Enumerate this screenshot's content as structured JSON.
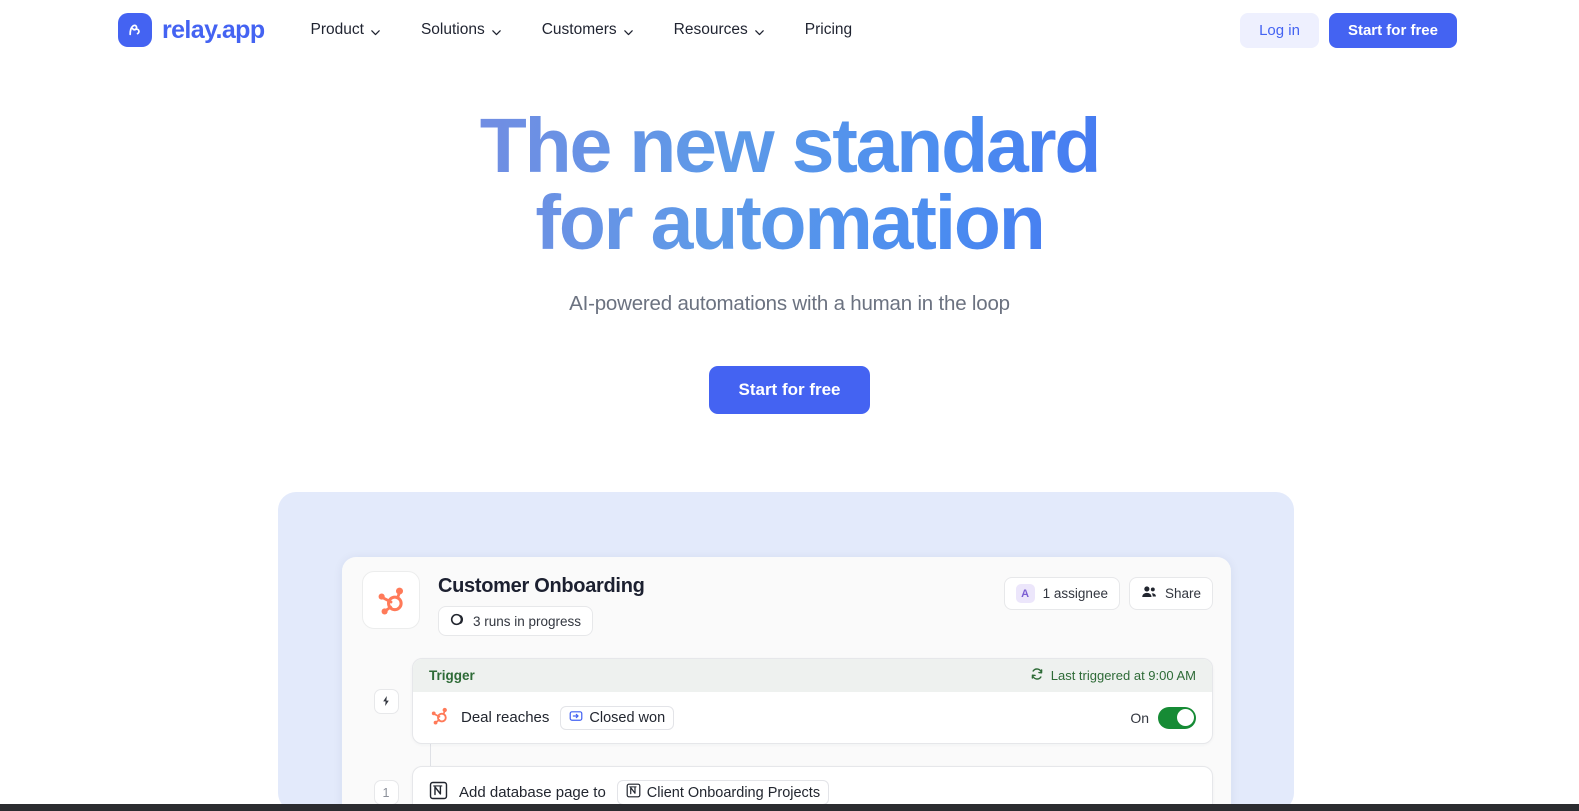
{
  "brand": {
    "name": "relay.app",
    "logo_icon": "relay-logo-icon",
    "accent": "#4463f2"
  },
  "nav": {
    "links": [
      {
        "label": "Product",
        "has_dropdown": true
      },
      {
        "label": "Solutions",
        "has_dropdown": true
      },
      {
        "label": "Customers",
        "has_dropdown": true
      },
      {
        "label": "Resources",
        "has_dropdown": true
      },
      {
        "label": "Pricing",
        "has_dropdown": false
      }
    ],
    "login_label": "Log in",
    "signup_label": "Start for free"
  },
  "hero": {
    "headline_line1": "The new standard",
    "headline_line2": "for automation",
    "subheadline": "AI-powered automations with a human in the loop",
    "cta_label": "Start for free",
    "gradient_from": "#9a7ad6",
    "gradient_to": "#3d5ef4"
  },
  "demo": {
    "showcase_bg": "#e3eafb",
    "app_icon": "hubspot-icon",
    "flow_title": "Customer Onboarding",
    "runs_chip": {
      "icon": "progress-circle-icon",
      "label": "3 runs in progress"
    },
    "assignee_pill": {
      "avatar_initial": "A",
      "label": "1 assignee",
      "avatar_color": "#7c5fd3"
    },
    "share_pill": {
      "icon": "people-icon",
      "label": "Share"
    },
    "trigger": {
      "header_label": "Trigger",
      "header_status_icon": "refresh-icon",
      "header_status": "Last triggered at 9:00 AM",
      "gutter_icon": "lightning-icon",
      "app_icon": "hubspot-icon",
      "text": "Deal reaches",
      "chip_icon": "stage-icon",
      "chip_label": "Closed won",
      "toggle_label": "On",
      "toggle_on": true,
      "toggle_color": "#168b35",
      "header_text_color": "#2e6b37"
    },
    "step_one": {
      "gutter_label": "1",
      "app_icon": "notion-icon",
      "text": "Add database page to",
      "chip_icon": "notion-icon",
      "chip_label": "Client Onboarding Projects"
    }
  }
}
